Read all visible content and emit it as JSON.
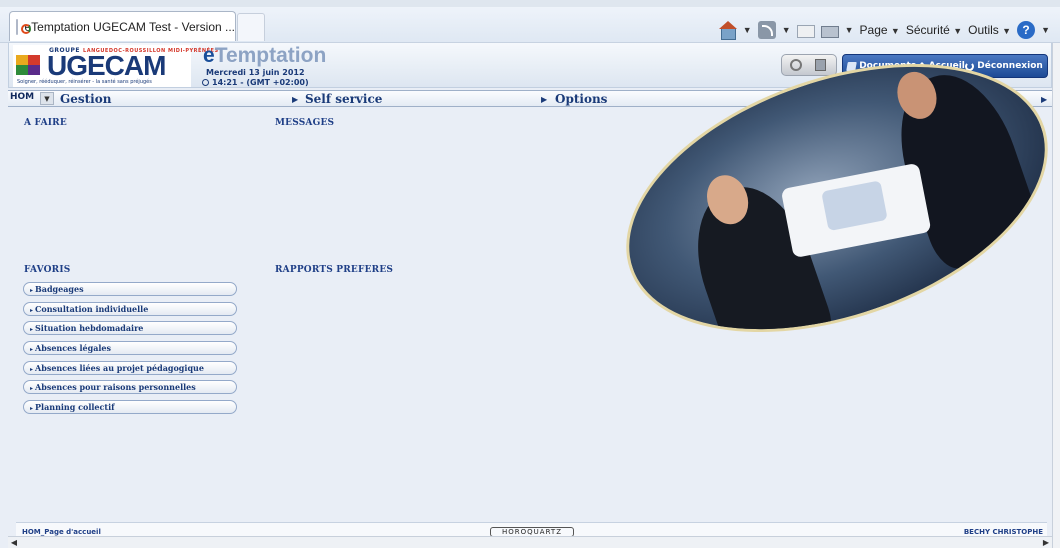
{
  "browser": {
    "tab_title": "eTemptation UGECAM Test - Version ...",
    "commands": {
      "page": "Page",
      "security": "Sécurité",
      "tools": "Outils"
    }
  },
  "header": {
    "logo": {
      "groupe": "GROUPE",
      "region": "LANGUEDOC-ROUSSILLON MIDI-PYRÉNÉES",
      "name": "UGECAM",
      "tagline": "Soigner, rééduquer, réinsérer - la santé sans préjugés"
    },
    "app_name_e": "e",
    "app_name_rest": "Temptation",
    "date": "Mercredi 13 juin 2012",
    "time": "14:21 - (GMT +02:00)",
    "buttons": {
      "documents": "Documents",
      "home": "Accueil",
      "logout": "Déconnexion"
    }
  },
  "menu": {
    "code": "HOM",
    "items": [
      "Gestion",
      "Self service",
      "Options",
      "?"
    ]
  },
  "sections": {
    "todo": "A FAIRE",
    "messages": "MESSAGES",
    "favorites": "FAVORIS",
    "reports": "RAPPORTS PREFERES"
  },
  "favorites": [
    "Badgeages",
    "Consultation individuelle",
    "Situation hebdomadaire",
    "Absences légales",
    "Absences liées au projet pédagogique",
    "Absences pour raisons personnelles",
    "Planning collectif"
  ],
  "status": {
    "left": "HOM_Page d'accueil",
    "center": "HOROQUARTZ",
    "right": "BECHY CHRISTOPHE"
  }
}
